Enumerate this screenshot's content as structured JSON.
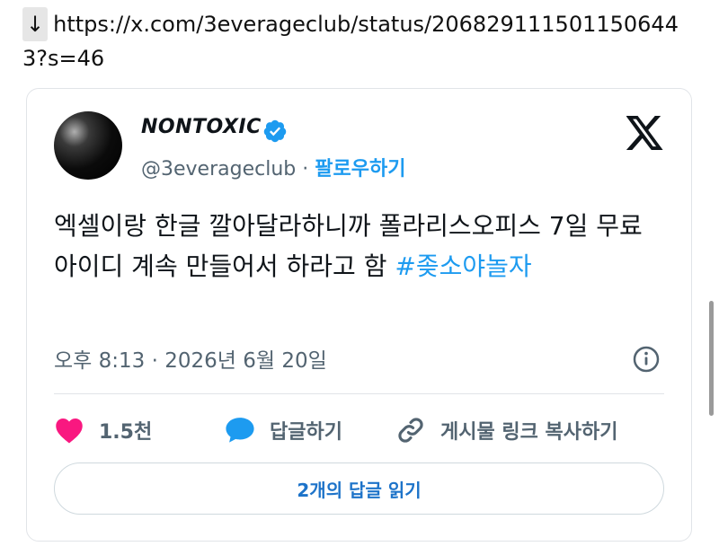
{
  "link": {
    "arrow": "↓",
    "url": "https://x.com/3everageclub/status/2068291115011506443?s=46"
  },
  "tweet": {
    "author_name": "NONTOXIC",
    "handle": "@3everageclub",
    "separator": "·",
    "follow_label": "팔로우하기",
    "text": "엑셀이랑 한글 깔아달라하니까 폴라리스오피스 7일 무료 아이디 계속 만들어서 하라고 함 ",
    "hashtag": "#좆소야놀자",
    "timestamp": "오후 8:13 · 2026년 6월 20일"
  },
  "actions": {
    "like_count": "1.5천",
    "reply_label": "답글하기",
    "copy_link_label": "게시물 링크 복사하기"
  },
  "replies_button": {
    "label": "2개의 답글 읽기"
  },
  "icons": {
    "verified": "verified-badge-icon",
    "x_logo": "x-logo-icon",
    "info": "info-icon",
    "heart": "heart-icon",
    "reply": "speech-bubble-icon",
    "link": "link-icon"
  },
  "colors": {
    "accent": "#1d9bf0",
    "heart": "#f91880",
    "muted": "#536471",
    "replies_text": "#1d73c9"
  }
}
